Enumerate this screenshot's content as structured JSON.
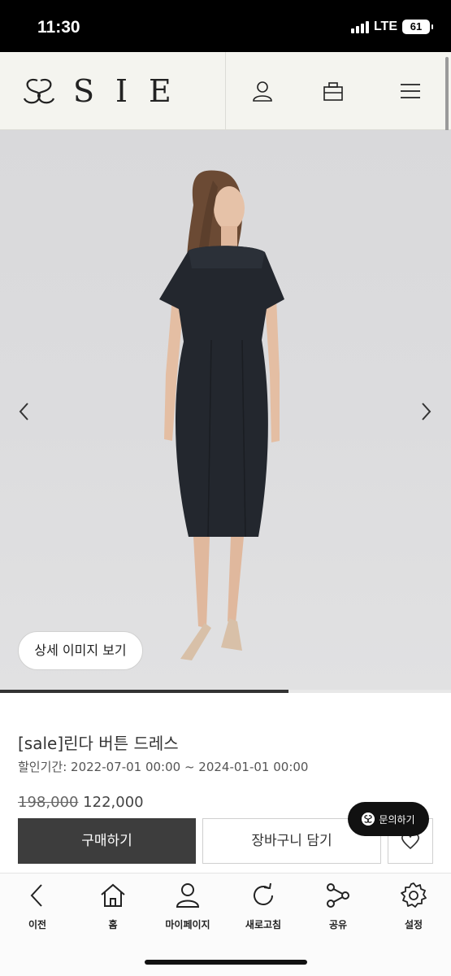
{
  "status": {
    "time": "11:30",
    "network": "LTE",
    "battery": "61"
  },
  "brand": {
    "name": "SIE"
  },
  "hero": {
    "detail_button": "상세 이미지 보기",
    "slide_progress": 0.64
  },
  "product": {
    "title": "[sale]린다 버튼 드레스",
    "sale_period": "할인기간: 2022-07-01 00:00 ~ 2024-01-01 00:00",
    "original_price": "198,000",
    "sale_price": "122,000"
  },
  "inquiry": {
    "label": "문의하기"
  },
  "actions": {
    "buy": "구매하기",
    "cart": "장바구니 담기"
  },
  "nav": [
    {
      "label": "이전",
      "icon": "back-icon"
    },
    {
      "label": "홈",
      "icon": "home-icon"
    },
    {
      "label": "마이페이지",
      "icon": "user-icon"
    },
    {
      "label": "새로고침",
      "icon": "refresh-icon"
    },
    {
      "label": "공유",
      "icon": "share-icon"
    },
    {
      "label": "설정",
      "icon": "settings-icon"
    }
  ],
  "colors": {
    "header_bg": "#f4f4ef",
    "buy_button": "#3d3d3d",
    "inquiry_bg": "#111111"
  }
}
